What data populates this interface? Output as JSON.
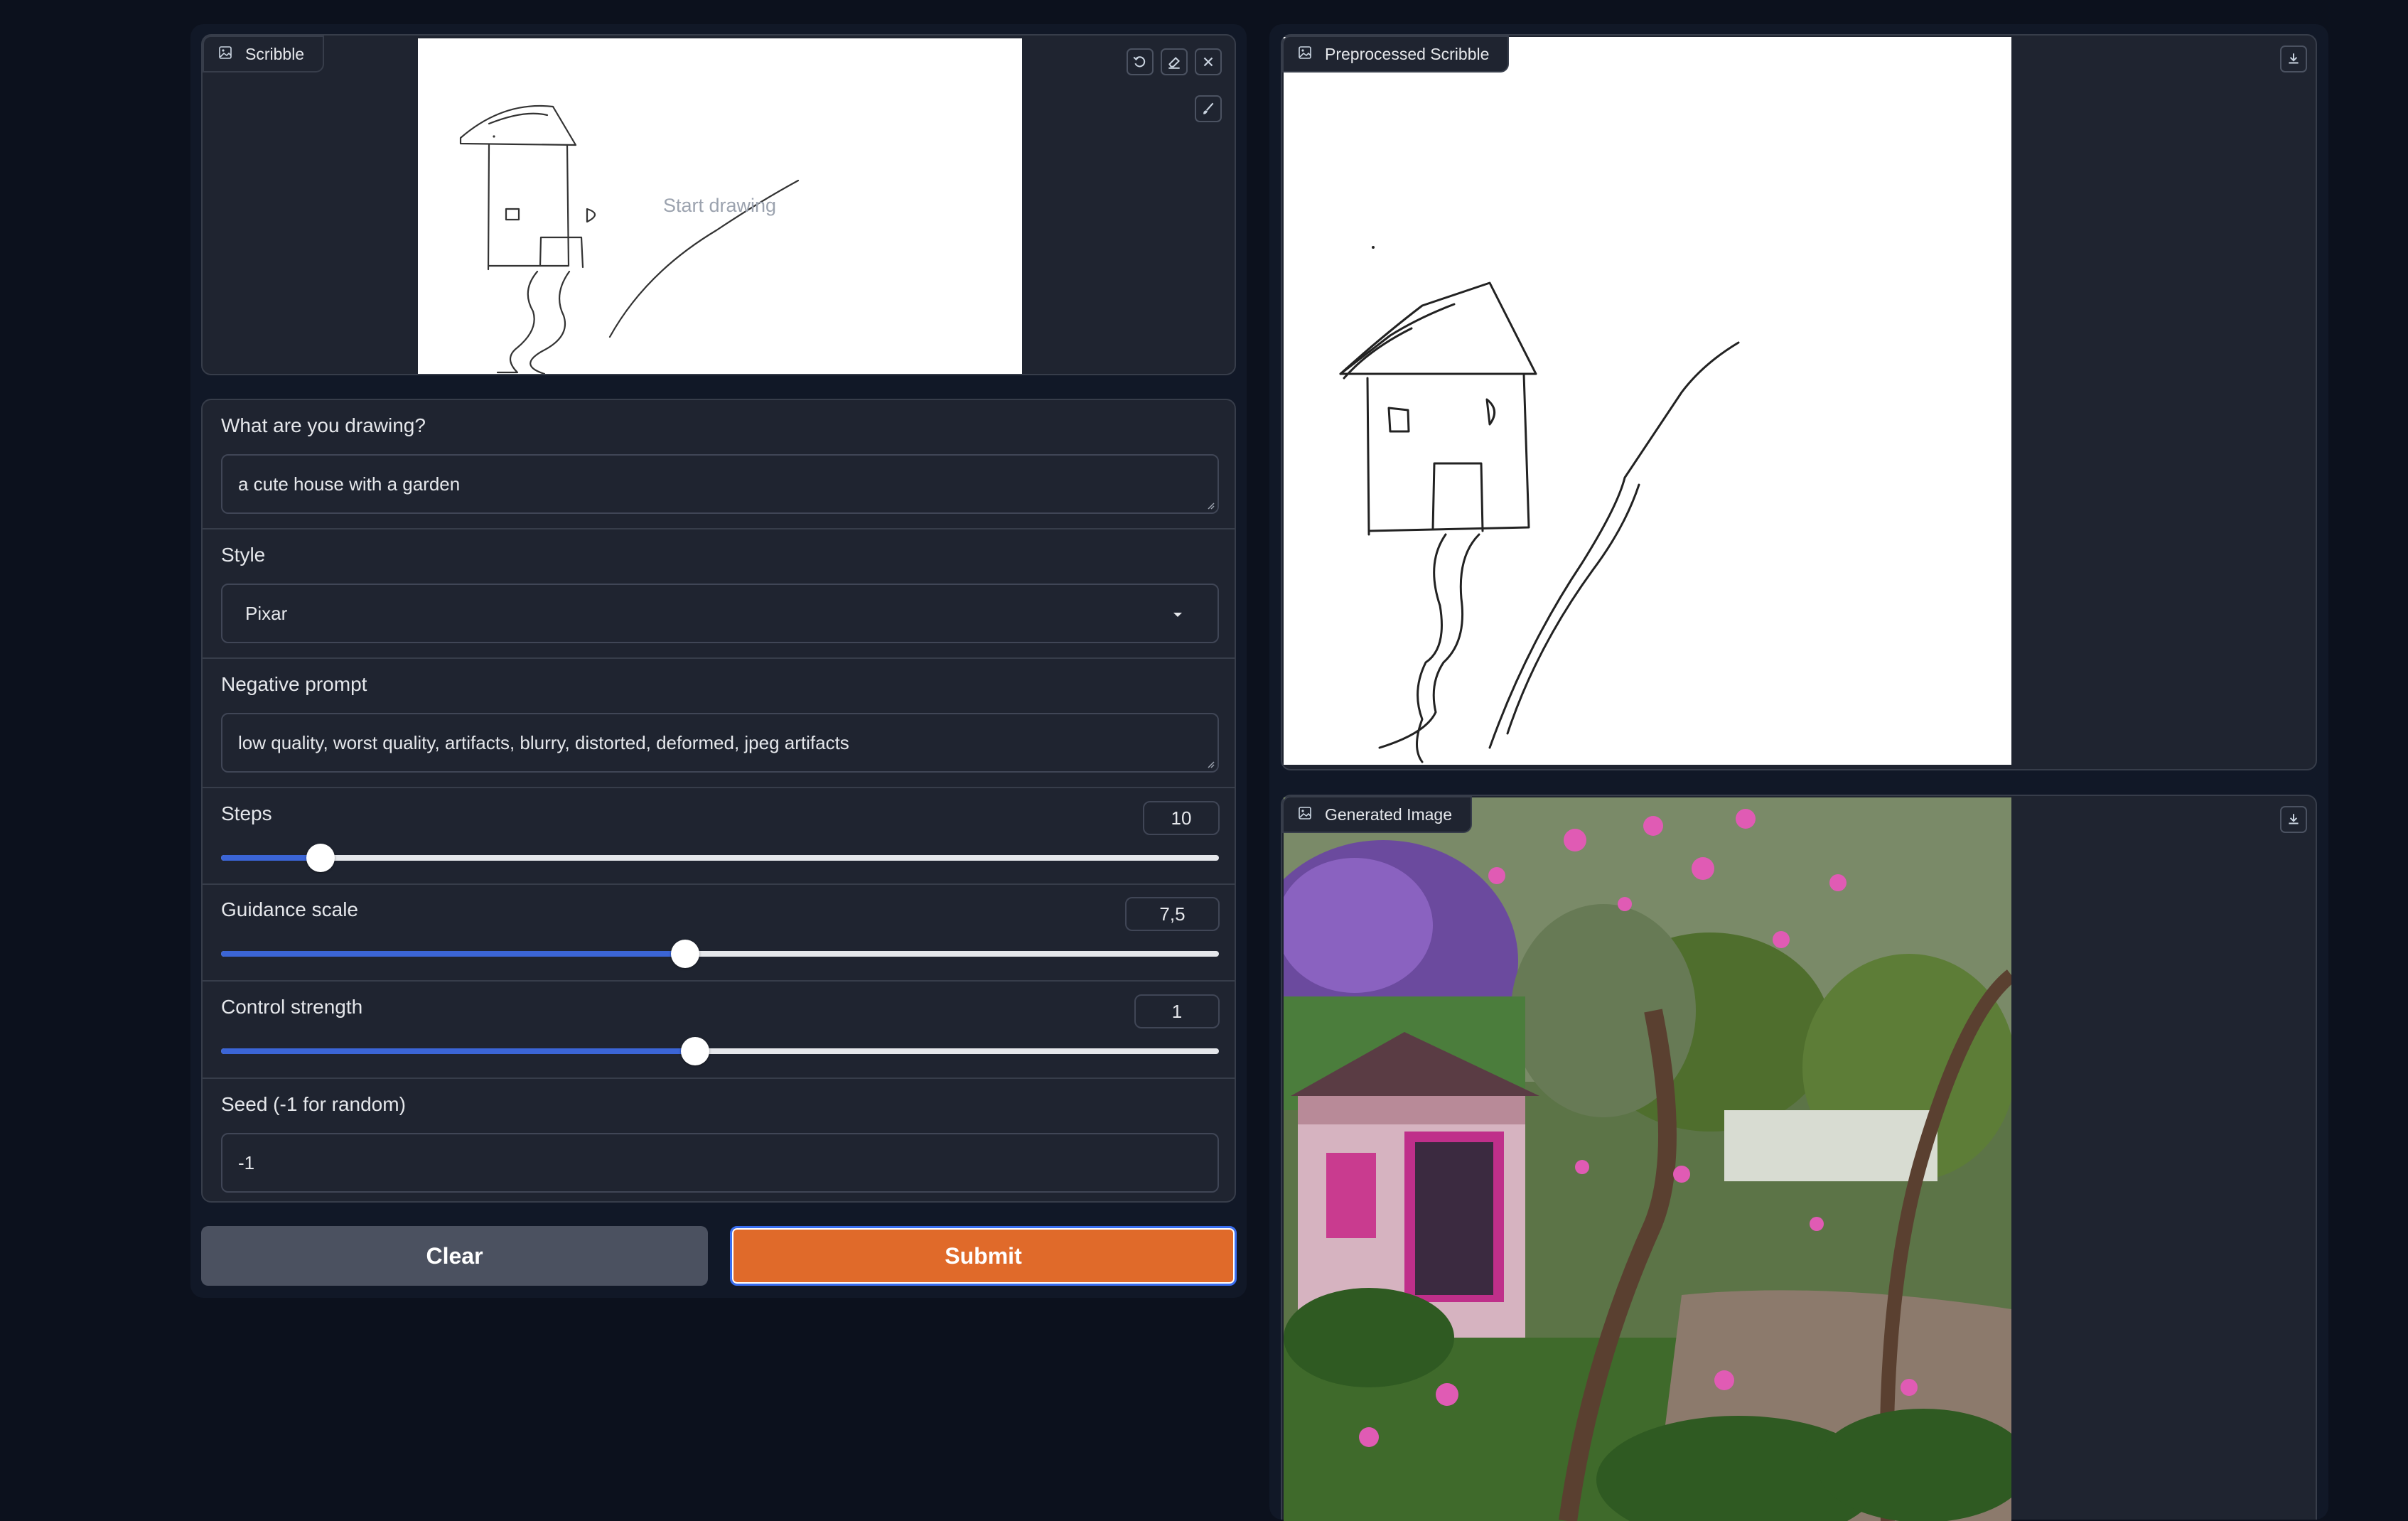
{
  "scribble": {
    "title": "Scribble",
    "placeholder": "Start drawing",
    "icons": [
      "image-icon",
      "undo-icon",
      "eraser-icon",
      "close-icon",
      "brush-icon"
    ]
  },
  "form": {
    "prompt_label": "What are you drawing?",
    "prompt_value": "a cute house with a garden",
    "style_label": "Style",
    "style_value": "Pixar",
    "negative_label": "Negative prompt",
    "negative_value": "low quality, worst quality, artifacts, blurry, distorted, deformed, jpeg artifacts",
    "steps_label": "Steps",
    "steps_value": "10",
    "steps_fraction": 0.1,
    "guidance_label": "Guidance scale",
    "guidance_value": "7,5",
    "guidance_fraction": 0.465,
    "control_label": "Control strength",
    "control_value": "1",
    "control_fraction": 0.475,
    "seed_label": "Seed (-1 for random)",
    "seed_value": "-1"
  },
  "buttons": {
    "clear": "Clear",
    "submit": "Submit"
  },
  "preprocessed": {
    "title": "Preprocessed Scribble"
  },
  "generated": {
    "title": "Generated Image"
  },
  "colors": {
    "background": "#0c111d",
    "panel": "#1f2430",
    "slider_fill": "#3b65d6",
    "submit": "#e06a2a",
    "submit_border": "#3a6ef0"
  }
}
